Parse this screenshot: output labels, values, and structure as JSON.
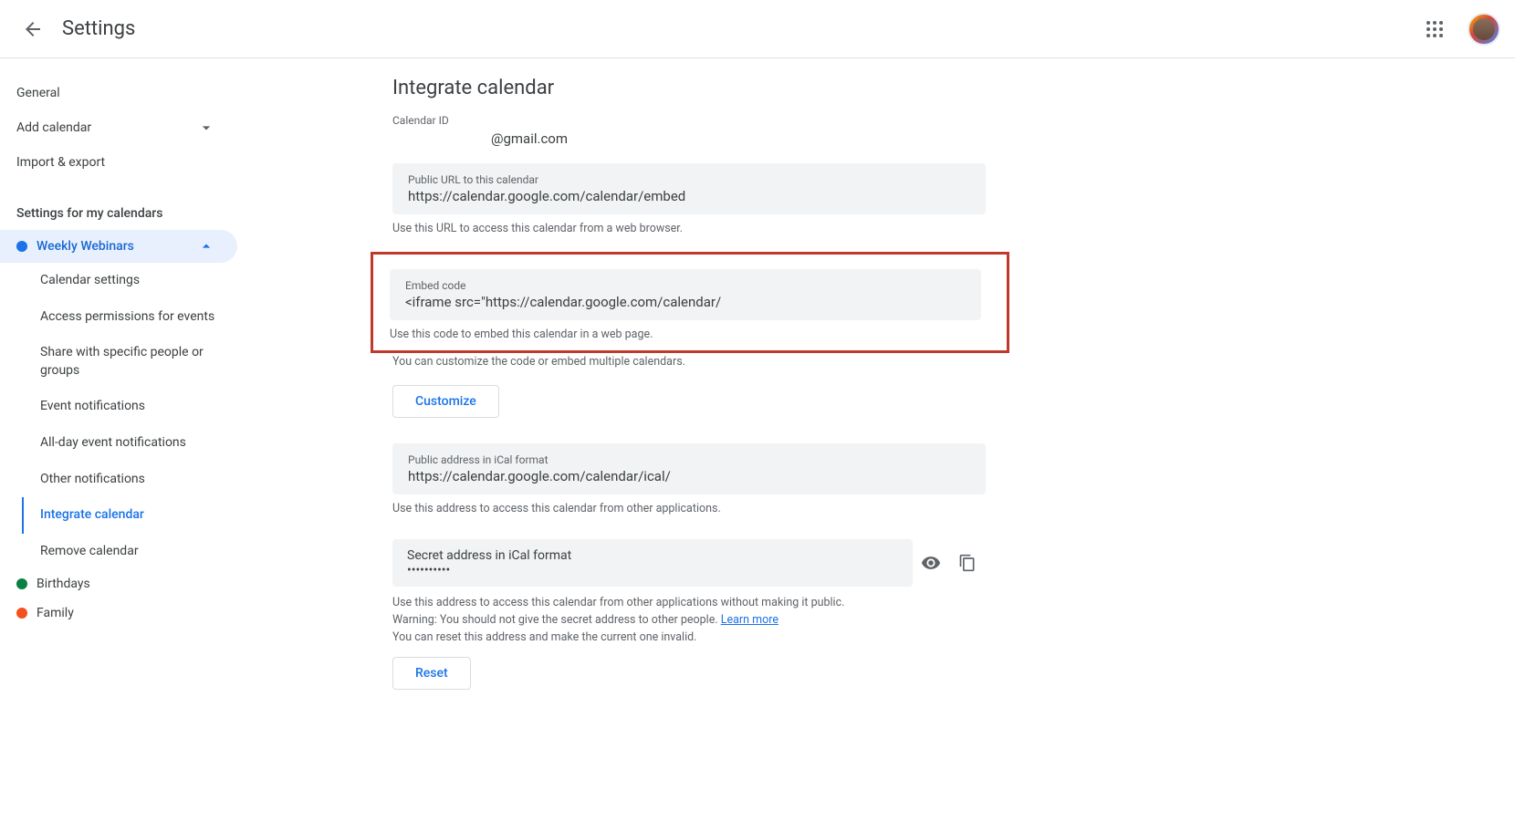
{
  "header": {
    "title": "Settings"
  },
  "sidebar": {
    "general": "General",
    "addCalendar": "Add calendar",
    "importExport": "Import & export",
    "sectionHeader": "Settings for my calendars",
    "calendars": [
      {
        "name": "Weekly Webinars",
        "color": "#1a73e8",
        "selected": true,
        "expanded": true
      },
      {
        "name": "Birthdays",
        "color": "#0b8043",
        "selected": false,
        "expanded": false
      },
      {
        "name": "Family",
        "color": "#f4511e",
        "selected": false,
        "expanded": false
      }
    ],
    "subItems": [
      "Calendar settings",
      "Access permissions for events",
      "Share with specific people or groups",
      "Event notifications",
      "All-day event notifications",
      "Other notifications",
      "Integrate calendar",
      "Remove calendar"
    ],
    "activeSubIndex": 6
  },
  "main": {
    "title": "Integrate calendar",
    "calendarIdLabel": "Calendar ID",
    "calendarIdValue": "@gmail.com",
    "publicUrl": {
      "label": "Public URL to this calendar",
      "value": "https://calendar.google.com/calendar/embed",
      "help": "Use this URL to access this calendar from a web browser."
    },
    "embed": {
      "label": "Embed code",
      "value": "<iframe src=\"https://calendar.google.com/calendar/",
      "help": "Use this code to embed this calendar in a web page.",
      "help2": "You can customize the code or embed multiple calendars.",
      "customize": "Customize"
    },
    "ical": {
      "label": "Public address in iCal format",
      "value": "https://calendar.google.com/calendar/ical/",
      "help": "Use this address to access this calendar from other applications."
    },
    "secret": {
      "label": "Secret address in iCal format",
      "value": "••••••••••",
      "help": "Use this address to access this calendar from other applications without making it public.",
      "warning": "Warning: You should not give the secret address to other people. ",
      "learnMore": "Learn more",
      "resetHelp": "You can reset this address and make the current one invalid.",
      "reset": "Reset"
    }
  }
}
